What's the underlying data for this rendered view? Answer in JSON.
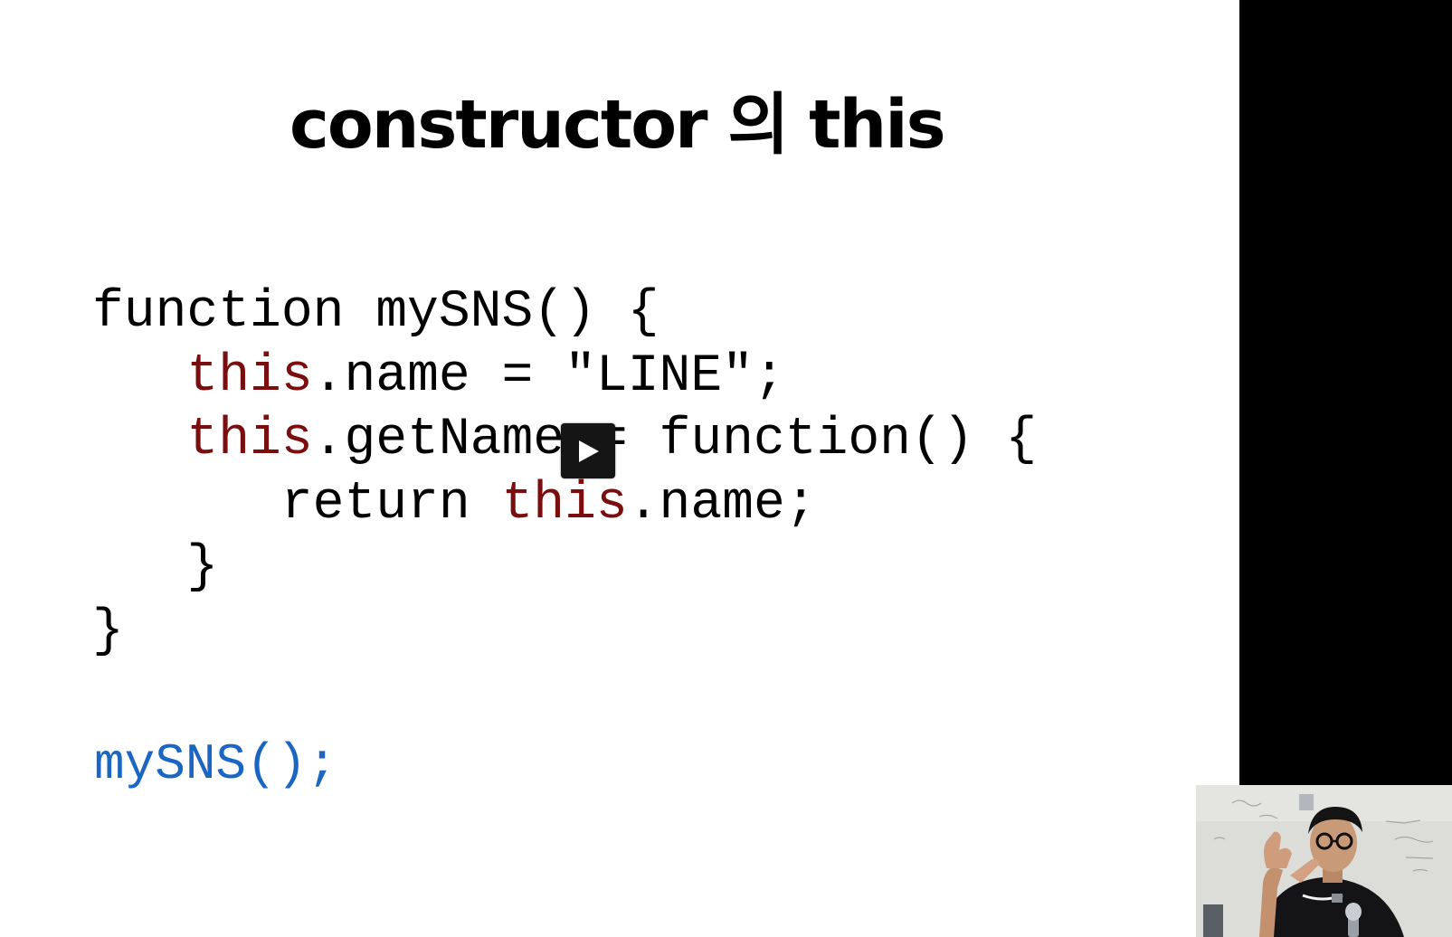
{
  "slide": {
    "title": "constructor 의 this",
    "code_lines": [
      {
        "indent": "",
        "keyword": "",
        "rest": "function mySNS() {"
      },
      {
        "indent": "   ",
        "keyword": "this",
        "rest": ".name = \"LINE\";"
      },
      {
        "indent": "   ",
        "keyword": "this",
        "rest": ".getName = function() {"
      },
      {
        "indent": "      ",
        "pre": "return ",
        "keyword": "this",
        "rest": ".name;"
      },
      {
        "indent": "   ",
        "keyword": "",
        "rest": "}"
      },
      {
        "indent": "",
        "keyword": "",
        "rest": "}"
      }
    ],
    "call_line": "mySNS();"
  },
  "player": {
    "play_icon": "play-icon"
  },
  "webcam": {
    "description_icon": "presenter-webcam"
  },
  "colors": {
    "keyword": "#7a0e0e",
    "call": "#1a66c2",
    "text": "#000000",
    "side_bar": "#000000"
  }
}
